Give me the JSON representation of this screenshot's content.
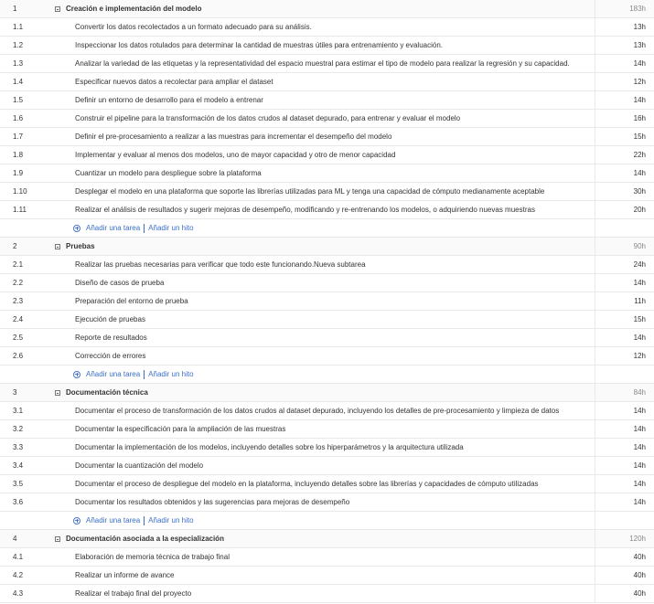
{
  "add_labels": {
    "task": "Añadir una tarea",
    "milestone": "Añadir un hito"
  },
  "groups": [
    {
      "num": "1",
      "name": "Creación e implementación del modelo",
      "hours": "183h",
      "tasks": [
        {
          "num": "1.1",
          "name": "Convertir los datos recolectados a un formato adecuado para su análisis.",
          "hours": "13h"
        },
        {
          "num": "1.2",
          "name": "Inspeccionar los datos rotulados para determinar la cantidad de muestras útiles para entrenamiento y evaluación.",
          "hours": "13h"
        },
        {
          "num": "1.3",
          "name": "Analizar la variedad de las etiquetas y la representatividad del espacio muestral para estimar el tipo de modelo para realizar la regresión y su capacidad.",
          "hours": "14h"
        },
        {
          "num": "1.4",
          "name": "Especificar nuevos datos a recolectar para ampliar el dataset",
          "hours": "12h"
        },
        {
          "num": "1.5",
          "name": "Definir un entorno de desarrollo para el modelo a entrenar",
          "hours": "14h"
        },
        {
          "num": "1.6",
          "name": "Construir el pipeline para la transformación de los datos crudos al dataset depurado, para entrenar y evaluar el modelo",
          "hours": "16h"
        },
        {
          "num": "1.7",
          "name": "Definir el pre-procesamiento a realizar a las muestras para incrementar el desempeño del modelo",
          "hours": "15h"
        },
        {
          "num": "1.8",
          "name": "Implementar y evaluar al menos dos modelos, uno de mayor capacidad y otro de menor capacidad",
          "hours": "22h"
        },
        {
          "num": "1.9",
          "name": "Cuantizar un modelo para despliegue sobre la plataforma",
          "hours": "14h"
        },
        {
          "num": "1.10",
          "name": "Desplegar el modelo en una plataforma que soporte las librerías utilizadas para ML y tenga una capacidad de cómputo medianamente aceptable",
          "hours": "30h"
        },
        {
          "num": "1.11",
          "name": "Realizar el análisis de resultados y sugerir mejoras de desempeño, modificando y re-entrenando los modelos, o adquiriendo nuevas muestras",
          "hours": "20h"
        }
      ]
    },
    {
      "num": "2",
      "name": "Pruebas",
      "hours": "90h",
      "tasks": [
        {
          "num": "2.1",
          "name": "Realizar las pruebas necesarias para verificar que todo este funcionando.Nueva subtarea",
          "hours": "24h"
        },
        {
          "num": "2.2",
          "name": "Diseño de casos de prueba",
          "hours": "14h"
        },
        {
          "num": "2.3",
          "name": "Preparación del entorno de prueba",
          "hours": "11h"
        },
        {
          "num": "2.4",
          "name": "Ejecución de pruebas",
          "hours": "15h"
        },
        {
          "num": "2.5",
          "name": "Reporte de resultados",
          "hours": "14h"
        },
        {
          "num": "2.6",
          "name": "Corrección de errores",
          "hours": "12h"
        }
      ]
    },
    {
      "num": "3",
      "name": "Documentación técnica",
      "hours": "84h",
      "tasks": [
        {
          "num": "3.1",
          "name": "Documentar el proceso de transformación de los datos crudos al dataset depurado, incluyendo los detalles de pre-procesamiento y limpieza de datos",
          "hours": "14h"
        },
        {
          "num": "3.2",
          "name": "Documentar la especificación para la ampliación de las muestras",
          "hours": "14h"
        },
        {
          "num": "3.3",
          "name": "Documentar la implementación de los modelos, incluyendo detalles sobre los hiperparámetros y la arquitectura utilizada",
          "hours": "14h"
        },
        {
          "num": "3.4",
          "name": "Documentar la cuantización del modelo",
          "hours": "14h"
        },
        {
          "num": "3.5",
          "name": "Documentar el proceso de despliegue del modelo en la plataforma, incluyendo detalles sobre las librerías y capacidades de cómputo utilizadas",
          "hours": "14h"
        },
        {
          "num": "3.6",
          "name": "Documentar los resultados obtenidos y las sugerencias para mejoras de desempeño",
          "hours": "14h"
        }
      ]
    },
    {
      "num": "4",
      "name": "Documentación asociada a la especialización",
      "hours": "120h",
      "tasks": [
        {
          "num": "4.1",
          "name": "Elaboración de memoria técnica de trabajo final",
          "hours": "40h"
        },
        {
          "num": "4.2",
          "name": "Realizar un informe de avance",
          "hours": "40h"
        },
        {
          "num": "4.3",
          "name": "Realizar el trabajo final del proyecto",
          "hours": "40h"
        }
      ],
      "no_add_row": true
    }
  ]
}
